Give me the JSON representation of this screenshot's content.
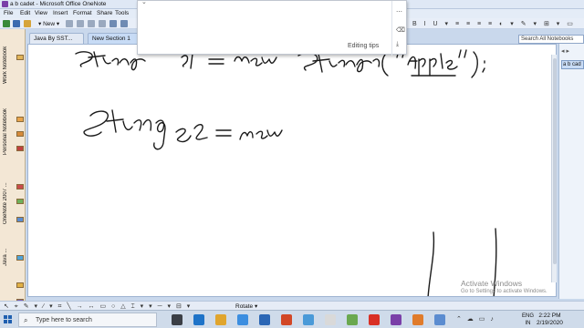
{
  "window": {
    "title": "a b cadet - Microsoft Office OneNote"
  },
  "menu": [
    "File",
    "Edit",
    "View",
    "Insert",
    "Format",
    "Share",
    "Tools"
  ],
  "toolbar": {
    "new_label": "New"
  },
  "popup": {
    "editing_tips": "Editing tips"
  },
  "notebooks": [
    "Work Notebook",
    "Personal Notebook",
    "OneNote 2007 ...",
    "Java ..."
  ],
  "tabs": [
    "Java By SST...",
    "New Section 1"
  ],
  "search": {
    "placeholder": "Search All Notebooks"
  },
  "page_list": {
    "current": "a b cad"
  },
  "ink": {
    "line1": "String s1 = new String(\"Apple\");",
    "line2": "String s2 = new"
  },
  "drawing_toolbar": {
    "rotate": "Rotate"
  },
  "watermark": {
    "line1": "Activate Windows",
    "line2": "Go to Settings to activate Windows."
  },
  "taskbar": {
    "search_placeholder": "Type here to search",
    "lang": "ENG",
    "region": "IN",
    "time": "2:22 PM",
    "date": "2/19/2020"
  },
  "colors": {
    "notebook_bar": "#f3e7d5",
    "active_tab": "#c7dbf5",
    "ink": "#1a1a1a"
  }
}
